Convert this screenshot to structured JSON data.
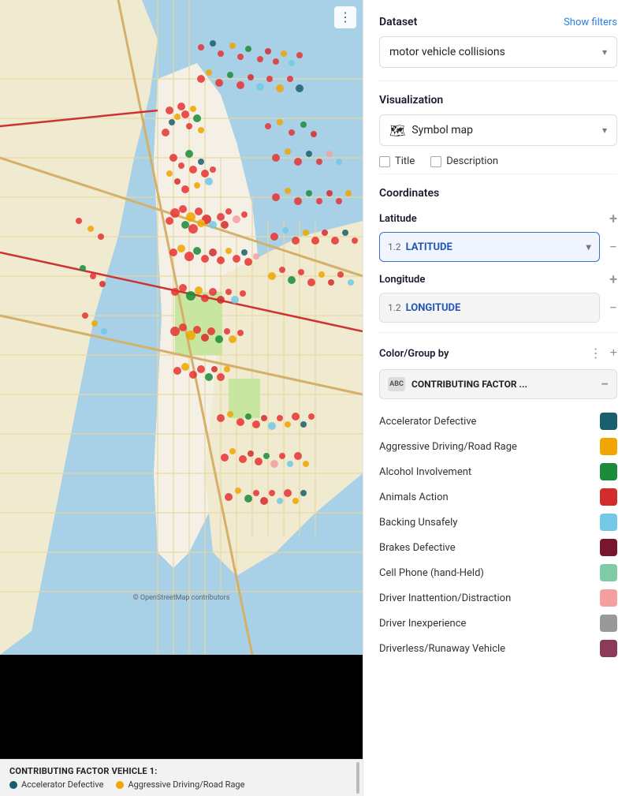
{
  "dataset": {
    "label": "Dataset",
    "show_filters": "Show filters",
    "selected": "motor vehicle collisions",
    "dropdown_arrow": "▾"
  },
  "visualization": {
    "label": "Visualization",
    "selected": "Symbol map",
    "dropdown_arrow": "▾",
    "checkboxes": [
      {
        "label": "Title"
      },
      {
        "label": "Description"
      }
    ]
  },
  "coordinates": {
    "label": "Coordinates",
    "latitude": {
      "label": "Latitude",
      "field_num": "1.2",
      "field_text": "LATITUDE",
      "dropdown_arrow": "▾"
    },
    "longitude": {
      "label": "Longitude",
      "field_num": "1.2",
      "field_text": "LONGITUDE"
    }
  },
  "color_group": {
    "label": "Color/Group by",
    "field_text": "CONTRIBUTING FACTOR ...",
    "contributing_label": "CONTRIBUTING FACTOR ..."
  },
  "legend_items": [
    {
      "name": "Accelerator Defective",
      "color": "#1a5f6e"
    },
    {
      "name": "Aggressive Driving/Road Rage",
      "color": "#f0a500"
    },
    {
      "name": "Alcohol Involvement",
      "color": "#1a8c3a"
    },
    {
      "name": "Animals Action",
      "color": "#d42b2b"
    },
    {
      "name": "Backing Unsafely",
      "color": "#73c8e8"
    },
    {
      "name": "Brakes Defective",
      "color": "#7a1530"
    },
    {
      "name": "Cell Phone (hand-Held)",
      "color": "#7ecba5"
    },
    {
      "name": "Driver Inattention/Distraction",
      "color": "#f4a0a0"
    },
    {
      "name": "Driver Inexperience",
      "color": "#999999"
    },
    {
      "name": "Driverless/Runaway Vehicle",
      "color": "#8b3a5a"
    }
  ],
  "map_legend": {
    "title": "CONTRIBUTING FACTOR VEHICLE 1:",
    "items": [
      {
        "label": "Accelerator Defective",
        "color": "#1a5f6e"
      },
      {
        "label": "Aggressive Driving/Road Rage",
        "color": "#f0a500"
      }
    ]
  }
}
